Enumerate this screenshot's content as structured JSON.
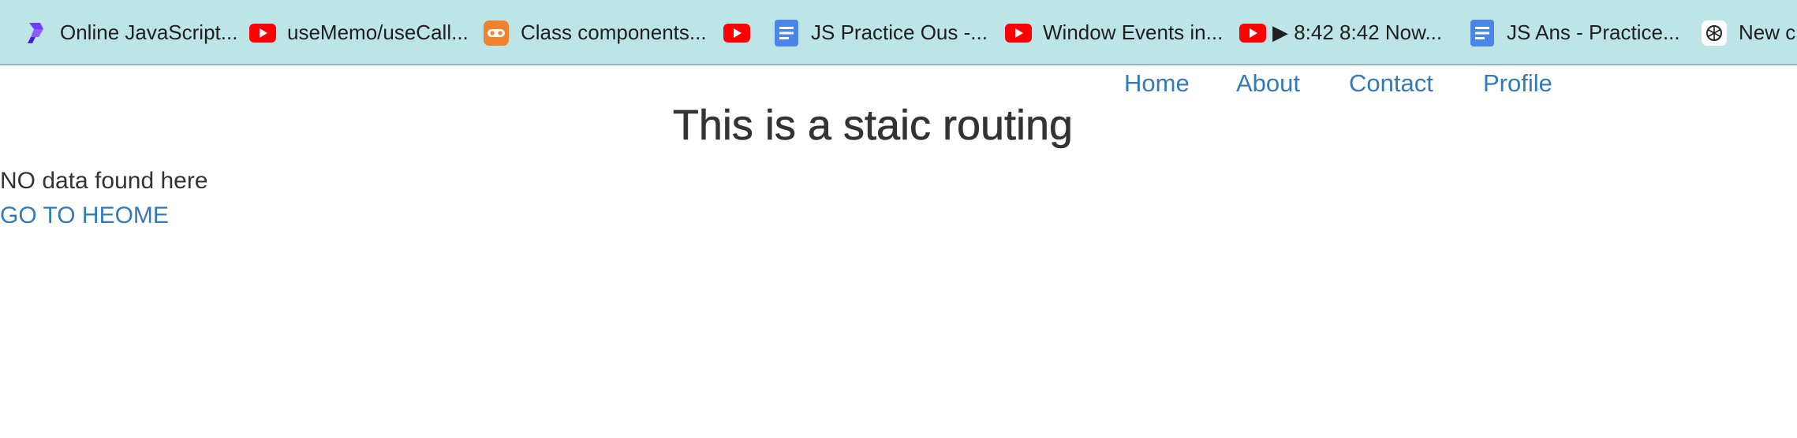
{
  "bookmarks": [
    {
      "icon": "replit-icon",
      "label": "Online JavaScript..."
    },
    {
      "icon": "youtube-icon",
      "label": "useMemo/useCall..."
    },
    {
      "icon": "scrimba-icon",
      "label": "Class components..."
    },
    {
      "icon": "youtube-icon",
      "label": ""
    },
    {
      "icon": "google-docs-icon",
      "label": "JS Practice Ous -..."
    },
    {
      "icon": "youtube-icon",
      "label": "Window Events in..."
    },
    {
      "icon": "youtube-icon",
      "label": "▶ 8:42 8:42 Now..."
    },
    {
      "icon": "google-docs-icon",
      "label": "JS Ans - Practice..."
    },
    {
      "icon": "chatgpt-icon",
      "label": "New ch"
    }
  ],
  "nav": {
    "home": "Home",
    "about": "About",
    "contact": "Contact",
    "profile": "Profile"
  },
  "page": {
    "title": "This is a staic routing",
    "message": "NO data found here",
    "home_link": "GO TO HEOME"
  },
  "colors": {
    "bookmarks_bg": "#bde4e6",
    "link": "#337ab7",
    "text": "#333333",
    "youtube_red": "#ff0000",
    "docs_blue": "#4a86e8"
  }
}
